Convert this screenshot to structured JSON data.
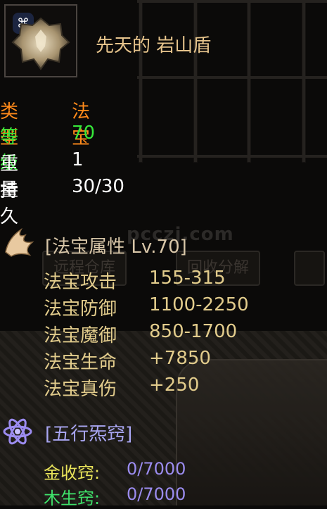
{
  "item": {
    "badge": "⌘",
    "name": "先天的 岩山盾"
  },
  "stats": [
    {
      "label": "类型",
      "value": "法宝",
      "label_color": "#ff8a1a",
      "value_color": "#ff8a1a"
    },
    {
      "label": "等级",
      "value": "70",
      "label_color": "#36e83a",
      "value_color": "#36e83a"
    },
    {
      "label": "重量",
      "value": "1",
      "label_color": "#ffffff",
      "value_color": "#ffffff"
    },
    {
      "label": "持久",
      "value": "30/30",
      "label_color": "#ffffff",
      "value_color": "#ffffff"
    }
  ],
  "treasure_section": {
    "icon": "wing-icon",
    "title": "[法宝属性 Lv.70]",
    "color": "#d8c6a8",
    "attributes": [
      {
        "label": "法宝攻击",
        "value": "155-315"
      },
      {
        "label": "法宝防御",
        "value": "1100-2250"
      },
      {
        "label": "法宝魔御",
        "value": "850-1700"
      },
      {
        "label": "法宝生命",
        "value": "+7850"
      },
      {
        "label": "法宝真伤",
        "value": "+250"
      }
    ]
  },
  "elements_section": {
    "icon": "atom-icon",
    "title": "[五行炁窍]",
    "color": "#a9a6f2",
    "slots": [
      {
        "label": "金收窍:",
        "value": "0/7000",
        "label_color": "#e8e35a"
      },
      {
        "label": "木生窍:",
        "value": "0/7000",
        "label_color": "#3fe06a"
      }
    ]
  },
  "background": {
    "watermark": "pcczj.com",
    "buttons": [
      "远程仓库",
      "回收分解"
    ]
  }
}
